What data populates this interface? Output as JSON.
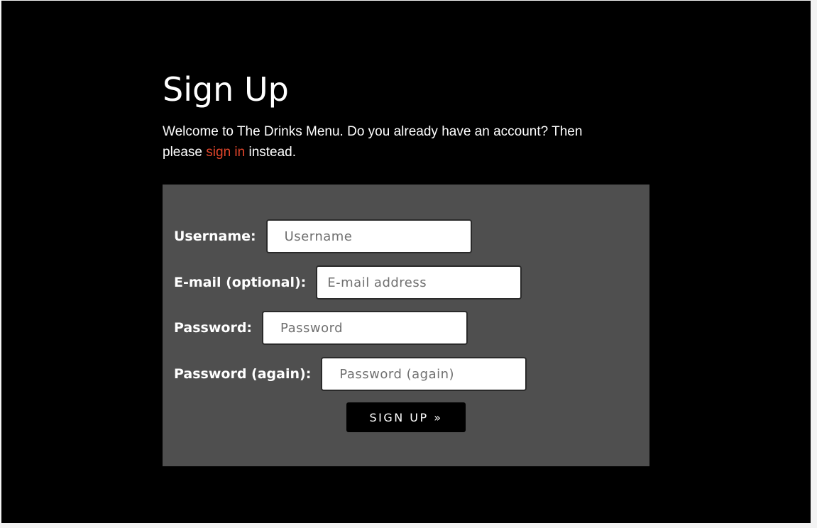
{
  "page": {
    "title": "Sign Up",
    "intro_before_link": "Welcome to The Drinks Menu. Do you already have an account? Then please ",
    "intro_link": "sign in",
    "intro_after_link": " instead."
  },
  "form": {
    "fields": [
      {
        "label": "Username:",
        "placeholder": "Username",
        "value": ""
      },
      {
        "label": "E-mail (optional):",
        "placeholder": "E-mail address",
        "value": ""
      },
      {
        "label": "Password:",
        "placeholder": "Password",
        "value": ""
      },
      {
        "label": "Password (again):",
        "placeholder": "Password (again)",
        "value": ""
      }
    ],
    "submit_label": "SIGN UP »"
  },
  "colors": {
    "background": "#000000",
    "panel": "#4f4f4f",
    "link": "#e0452b",
    "text": "#ffffff"
  }
}
